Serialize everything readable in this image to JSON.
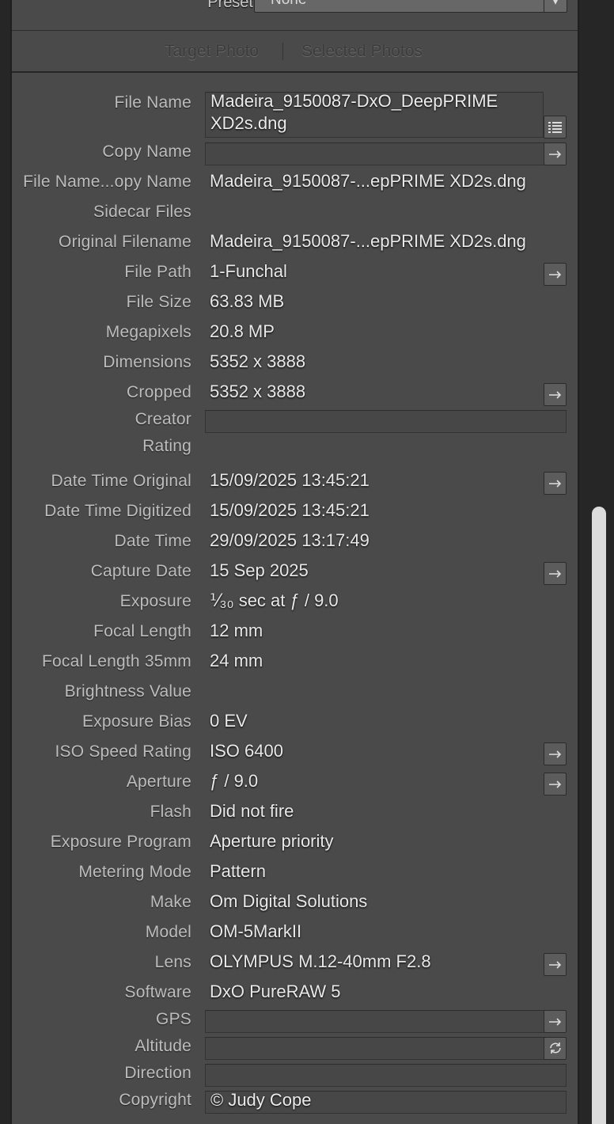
{
  "preset": {
    "label": "Preset",
    "value": "None"
  },
  "tabs": {
    "target": "Target Photo",
    "selected": "Selected Photos"
  },
  "file_name": {
    "label": "File Name",
    "line1": "Madeira_9150087-DxO_DeepPRIME",
    "line2": "XD2s.dng"
  },
  "copy_name": {
    "label": "Copy Name",
    "value": ""
  },
  "rows_top": [
    {
      "label": "File Name...opy Name",
      "value": "Madeira_9150087-...epPRIME XD2s.dng"
    },
    {
      "label": "Sidecar Files",
      "value": ""
    },
    {
      "label": "Original Filename",
      "value": "Madeira_9150087-...epPRIME XD2s.dng"
    },
    {
      "label": "File Path",
      "value": "1-Funchal"
    },
    {
      "label": "File Size",
      "value": "63.83 MB"
    },
    {
      "label": "Megapixels",
      "value": "20.8 MP"
    },
    {
      "label": "Dimensions",
      "value": "5352 x 3888"
    },
    {
      "label": "Cropped",
      "value": "5352 x 3888"
    }
  ],
  "creator": {
    "label": "Creator",
    "value": ""
  },
  "rating": {
    "label": "Rating",
    "value": ""
  },
  "rows_exif": [
    {
      "label": "Date Time Original",
      "value": "15/09/2025 13:45:21"
    },
    {
      "label": "Date Time Digitized",
      "value": "15/09/2025 13:45:21"
    },
    {
      "label": "Date Time",
      "value": "29/09/2025 13:17:49"
    },
    {
      "label": "Capture Date",
      "value": "15 Sep 2025"
    },
    {
      "label": "Exposure",
      "value": "⅟₃₀ sec at ƒ / 9.0"
    },
    {
      "label": "Focal Length",
      "value": "12 mm"
    },
    {
      "label": "Focal Length 35mm",
      "value": "24 mm"
    },
    {
      "label": "Brightness Value",
      "value": ""
    },
    {
      "label": "Exposure Bias",
      "value": "0 EV"
    },
    {
      "label": "ISO Speed Rating",
      "value": "ISO 6400"
    },
    {
      "label": "Aperture",
      "value": "ƒ / 9.0"
    },
    {
      "label": "Flash",
      "value": "Did not fire"
    },
    {
      "label": "Exposure Program",
      "value": "Aperture priority"
    },
    {
      "label": "Metering Mode",
      "value": "Pattern"
    },
    {
      "label": "Make",
      "value": "Om Digital Solutions"
    },
    {
      "label": "Model",
      "value": "OM-5MarkII"
    },
    {
      "label": "Lens",
      "value": "OLYMPUS M.12-40mm F2.8"
    },
    {
      "label": "Software",
      "value": "DxO PureRAW 5"
    }
  ],
  "gps": {
    "label": "GPS",
    "value": ""
  },
  "altitude": {
    "label": "Altitude",
    "value": ""
  },
  "direction": {
    "label": "Direction",
    "value": ""
  },
  "copyright": {
    "label": "Copyright",
    "value": "© Judy Cope"
  }
}
